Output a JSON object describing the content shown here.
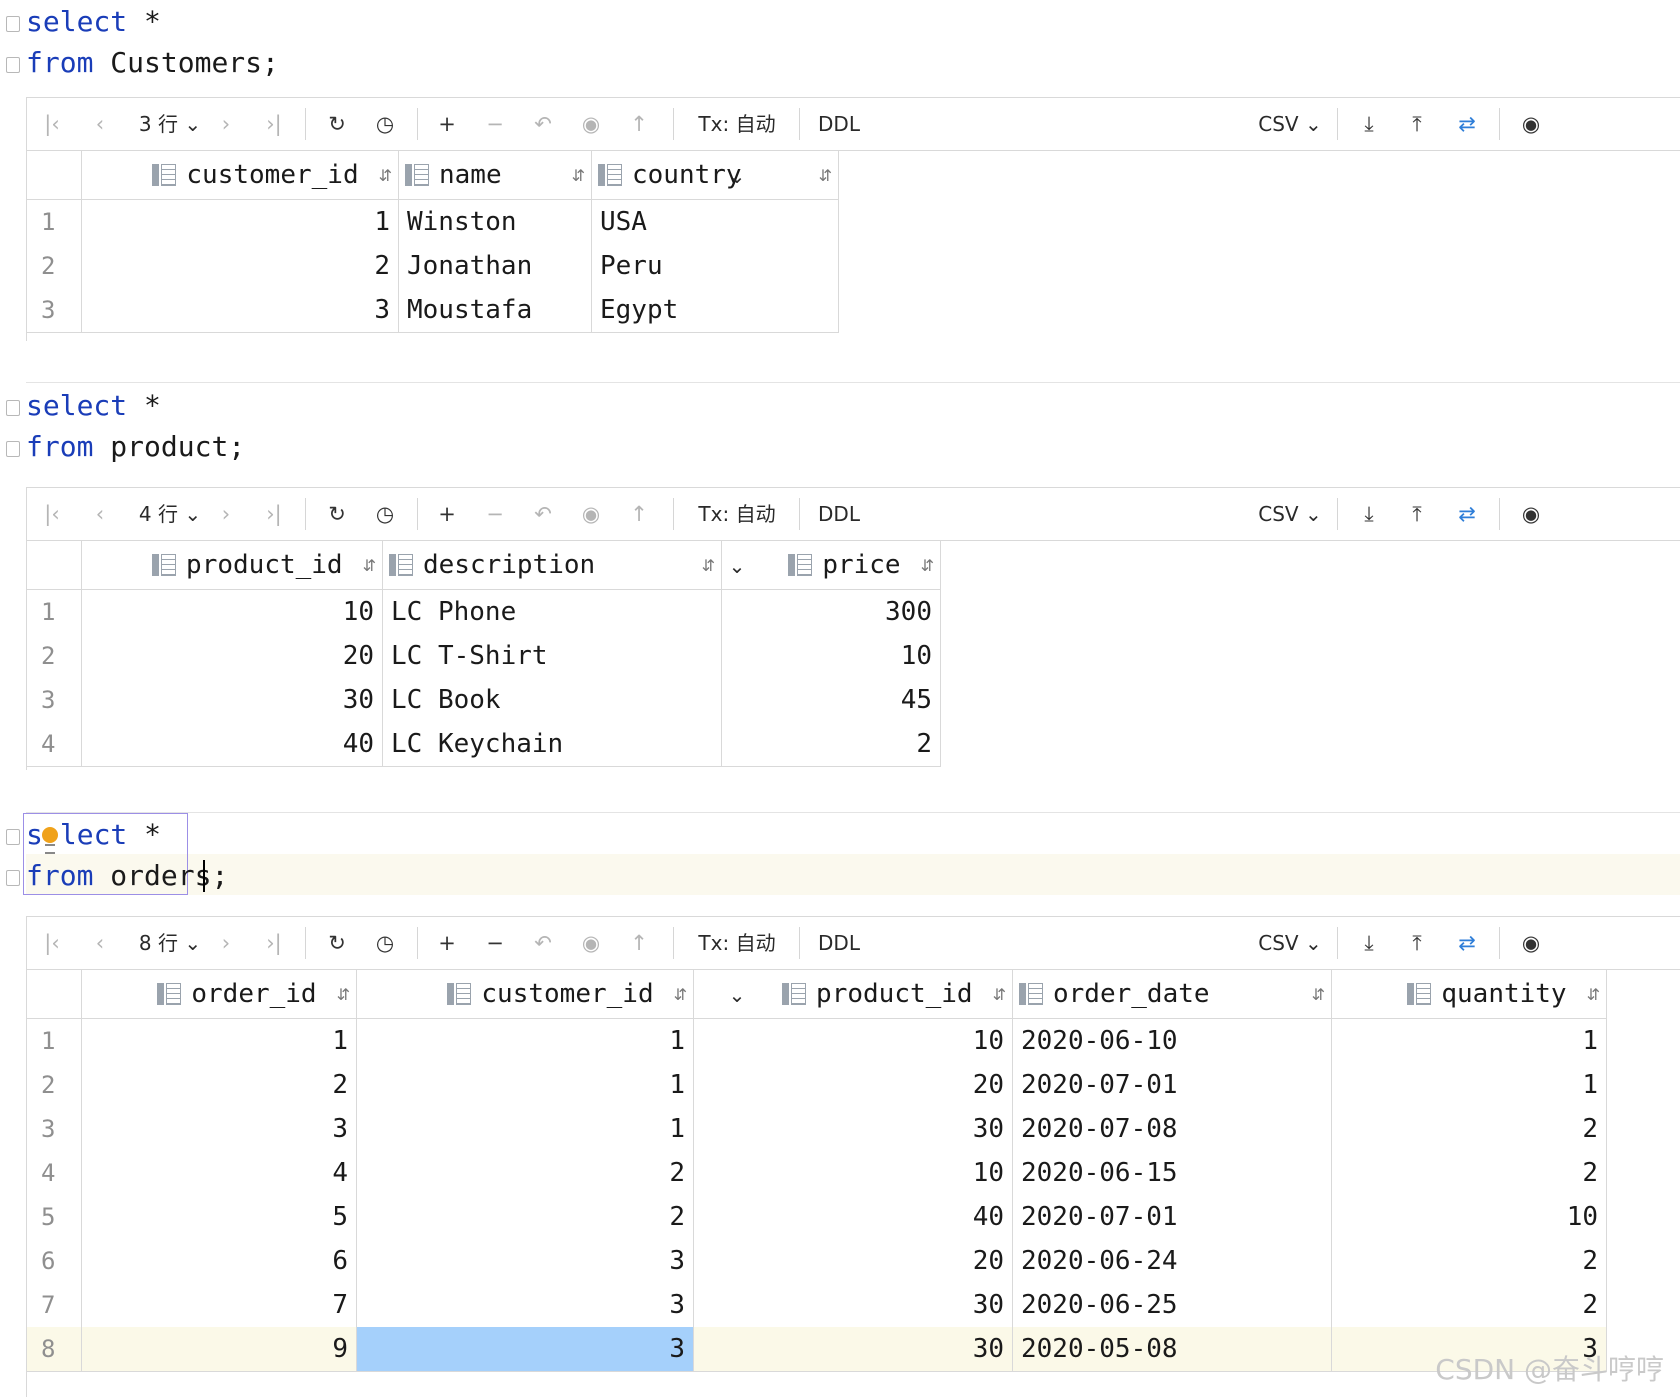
{
  "blocks": [
    {
      "sql": {
        "kw1": "select",
        "rest1": " *",
        "kw2": "from",
        "rest2": " Customers;"
      },
      "toolbar": {
        "rows": "3 行",
        "tx": "Tx: 自动",
        "ddl": "DDL",
        "export": "CSV"
      },
      "columns": [
        "customer_id",
        "name",
        "country"
      ],
      "rows": [
        [
          "1",
          "1",
          "Winston",
          "USA"
        ],
        [
          "2",
          "2",
          "Jonathan",
          "Peru"
        ],
        [
          "3",
          "3",
          "Moustafa",
          "Egypt"
        ]
      ]
    },
    {
      "sql": {
        "kw1": "select",
        "rest1": " *",
        "kw2": "from",
        "rest2": " product;"
      },
      "toolbar": {
        "rows": "4 行",
        "tx": "Tx: 自动",
        "ddl": "DDL",
        "export": "CSV"
      },
      "columns": [
        "product_id",
        "description",
        "price"
      ],
      "rows": [
        [
          "1",
          "10",
          "LC Phone",
          "300"
        ],
        [
          "2",
          "20",
          "LC T-Shirt",
          "10"
        ],
        [
          "3",
          "30",
          "LC Book",
          "45"
        ],
        [
          "4",
          "40",
          "LC Keychain",
          "2"
        ]
      ]
    },
    {
      "sql": {
        "kw1a": "s",
        "kw1b": "lect",
        "rest1": " *",
        "kw2": "from",
        "rest2": " orders;"
      },
      "toolbar": {
        "rows": "8 行",
        "tx": "Tx: 自动",
        "ddl": "DDL",
        "export": "CSV"
      },
      "columns": [
        "order_id",
        "customer_id",
        "product_id",
        "order_date",
        "quantity"
      ],
      "rows": [
        [
          "1",
          "1",
          "1",
          "10",
          "2020-06-10",
          "1"
        ],
        [
          "2",
          "2",
          "1",
          "20",
          "2020-07-01",
          "1"
        ],
        [
          "3",
          "3",
          "1",
          "30",
          "2020-07-08",
          "2"
        ],
        [
          "4",
          "4",
          "2",
          "10",
          "2020-06-15",
          "2"
        ],
        [
          "5",
          "5",
          "2",
          "40",
          "2020-07-01",
          "10"
        ],
        [
          "6",
          "6",
          "3",
          "20",
          "2020-06-24",
          "2"
        ],
        [
          "7",
          "7",
          "3",
          "30",
          "2020-06-25",
          "2"
        ],
        [
          "8",
          "9",
          "3",
          "30",
          "2020-05-08",
          "3"
        ]
      ]
    }
  ],
  "watermark": "CSDN @奋斗哼哼",
  "colors": {
    "keyword": "#1a3db8",
    "selected_cell": "#a5d0fb",
    "current_row": "#fbf9e8",
    "toolbar_accent": "#2f7ed8"
  }
}
